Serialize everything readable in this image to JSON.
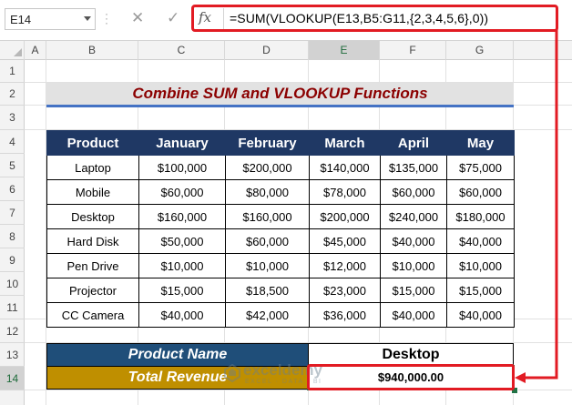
{
  "formula_bar": {
    "name_box": "E14",
    "formula": "=SUM(VLOOKUP(E13,B5:G11,{2,3,4,5,6},0))",
    "fx_label": "fx"
  },
  "columns": [
    "A",
    "B",
    "C",
    "D",
    "E",
    "F",
    "G"
  ],
  "rows": [
    "1",
    "2",
    "3",
    "4",
    "5",
    "6",
    "7",
    "8",
    "9",
    "10",
    "11",
    "12",
    "13",
    "14"
  ],
  "title": "Combine SUM and VLOOKUP Functions",
  "table": {
    "headers": [
      "Product",
      "January",
      "February",
      "March",
      "April",
      "May"
    ],
    "rows": [
      [
        "Laptop",
        "$100,000",
        "$200,000",
        "$140,000",
        "$135,000",
        "$75,000"
      ],
      [
        "Mobile",
        "$60,000",
        "$80,000",
        "$78,000",
        "$60,000",
        "$60,000"
      ],
      [
        "Desktop",
        "$160,000",
        "$160,000",
        "$200,000",
        "$240,000",
        "$180,000"
      ],
      [
        "Hard Disk",
        "$50,000",
        "$60,000",
        "$45,000",
        "$40,000",
        "$40,000"
      ],
      [
        "Pen Drive",
        "$10,000",
        "$10,000",
        "$12,000",
        "$10,000",
        "$10,000"
      ],
      [
        "Projector",
        "$15,000",
        "$18,500",
        "$23,000",
        "$15,000",
        "$15,000"
      ],
      [
        "CC Camera",
        "$40,000",
        "$42,000",
        "$36,000",
        "$40,000",
        "$40,000"
      ]
    ]
  },
  "summary": {
    "product_label": "Product Name",
    "product_value": "Desktop",
    "revenue_label": "Total Revenue",
    "revenue_value": "$940,000.00"
  },
  "watermark": {
    "name": "exceldemy",
    "tagline": "EXCEL · DATA · BI"
  },
  "colors": {
    "header_fill": "#1f3864",
    "title_text": "#8b0000",
    "label_fill_1": "#1f4e79",
    "label_fill_2": "#bf8f00",
    "highlight": "#e21b23",
    "selection": "#217346"
  }
}
